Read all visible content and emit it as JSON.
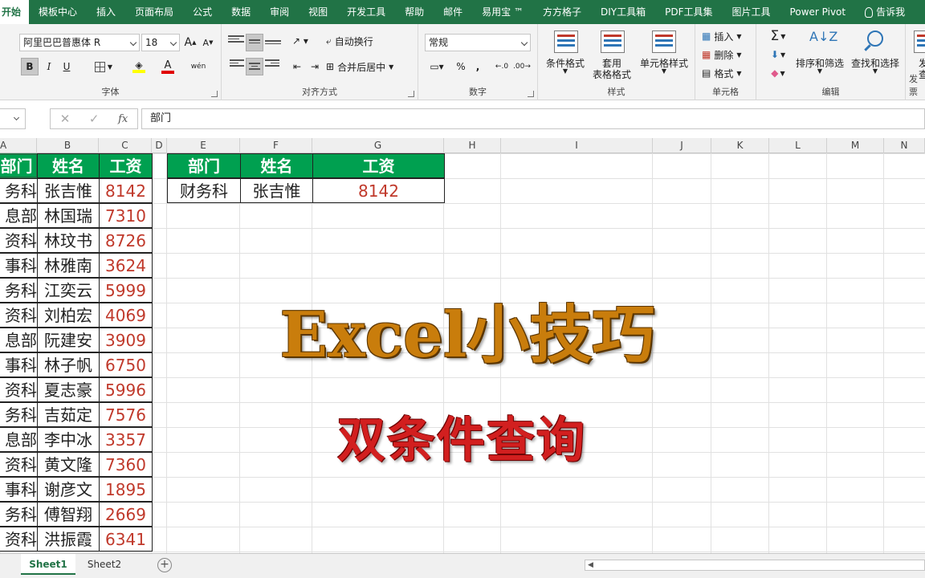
{
  "menu": {
    "tabs": [
      "开始",
      "模板中心",
      "插入",
      "页面布局",
      "公式",
      "数据",
      "审阅",
      "视图",
      "开发工具",
      "帮助",
      "邮件",
      "易用宝 ™",
      "方方格子",
      "DIY工具箱",
      "PDF工具集",
      "图片工具",
      "Power Pivot"
    ],
    "tell_me": "告诉我"
  },
  "ribbon": {
    "font": {
      "family": "阿里巴巴普惠体 R",
      "size": "18",
      "bold": "B",
      "italic": "I",
      "underline": "U",
      "label": "字体",
      "grow": "A",
      "shrink": "A",
      "phonetic": "wén"
    },
    "alignment": {
      "wrap_text": "自动换行",
      "merge_center": "合并后居中",
      "label": "对齐方式"
    },
    "number": {
      "format": "常规",
      "percent": "%",
      "comma": ",",
      "label": "数字"
    },
    "styles": {
      "conditional": "条件格式",
      "table_format_1": "套用",
      "table_format_2": "表格格式",
      "cell_styles": "单元格样式",
      "label": "样式"
    },
    "cells": {
      "insert": "插入",
      "delete": "删除",
      "format": "格式",
      "label": "单元格"
    },
    "editing": {
      "sort_filter": "排序和筛选",
      "find_select": "查找和选择",
      "label": "编辑",
      "sigma": "Σ"
    },
    "extra": {
      "label": "发票",
      "text_1": "发",
      "text_2": "查"
    }
  },
  "formula_bar": {
    "value": "部门",
    "fx": "fx",
    "cancel": "✕",
    "confirm": "✓"
  },
  "columns": [
    "A",
    "B",
    "C",
    "D",
    "E",
    "F",
    "G",
    "H",
    "I",
    "J",
    "K",
    "L",
    "M",
    "N"
  ],
  "main_table": {
    "headers": [
      "部门",
      "姓名",
      "工资"
    ],
    "rows": [
      [
        "务科",
        "张吉惟",
        "8142"
      ],
      [
        "息部",
        "林国瑞",
        "7310"
      ],
      [
        "资科",
        "林玟书",
        "8726"
      ],
      [
        "事科",
        "林雅南",
        "3624"
      ],
      [
        "务科",
        "江奕云",
        "5999"
      ],
      [
        "资科",
        "刘柏宏",
        "4069"
      ],
      [
        "息部",
        "阮建安",
        "3909"
      ],
      [
        "事科",
        "林子帆",
        "6750"
      ],
      [
        "资科",
        "夏志豪",
        "5996"
      ],
      [
        "务科",
        "吉茹定",
        "7576"
      ],
      [
        "息部",
        "李中冰",
        "3357"
      ],
      [
        "资科",
        "黄文隆",
        "7360"
      ],
      [
        "事科",
        "谢彦文",
        "1895"
      ],
      [
        "务科",
        "傅智翔",
        "2669"
      ],
      [
        "资科",
        "洪振霞",
        "6341"
      ]
    ]
  },
  "lookup_table": {
    "headers": [
      "部门",
      "姓名",
      "工资"
    ],
    "row": [
      "财务科",
      "张吉惟",
      "8142"
    ]
  },
  "overlay": {
    "title": "Excel小技巧",
    "subtitle": "双条件查询"
  },
  "sheets": [
    "Sheet1",
    "Sheet2"
  ],
  "colors": {
    "excel_green": "#217346",
    "header_green": "#00a050",
    "salary_red": "#c0392b",
    "title_orange": "#c97d0c",
    "subtitle_red": "#d21f1f"
  }
}
